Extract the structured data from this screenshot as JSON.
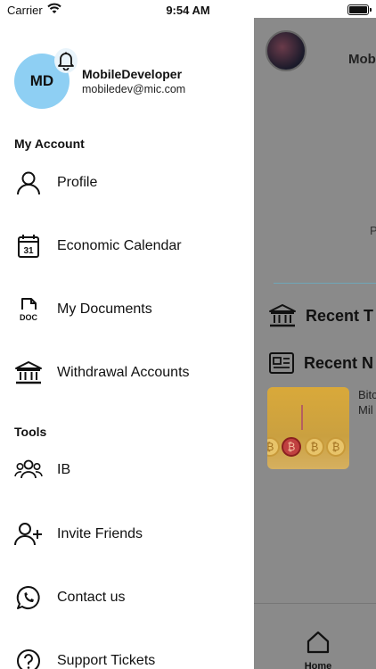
{
  "status_bar": {
    "carrier": "Carrier",
    "time": "9:54 AM"
  },
  "user": {
    "initials": "MD",
    "name": "MobileDeveloper",
    "email": "mobiledev@mic.com"
  },
  "sections": {
    "account_title": "My Account",
    "tools_title": "Tools"
  },
  "account_items": [
    {
      "label": "Profile",
      "icon": "person-icon"
    },
    {
      "label": "Economic Calendar",
      "icon": "calendar-icon"
    },
    {
      "label": "My Documents",
      "icon": "document-icon"
    },
    {
      "label": "Withdrawal Accounts",
      "icon": "bank-icon"
    }
  ],
  "tool_items": [
    {
      "label": "IB",
      "icon": "group-icon"
    },
    {
      "label": "Invite Friends",
      "icon": "add-user-icon"
    },
    {
      "label": "Contact us",
      "icon": "whatsapp-icon"
    },
    {
      "label": "Support Tickets",
      "icon": "help-icon"
    }
  ],
  "icon_texts": {
    "calendar_day": "31",
    "document_tag": "DOC"
  },
  "background": {
    "name_partial": "Mob",
    "p_partial": "P",
    "recent_transactions_partial": "Recent T",
    "recent_news_partial": "Recent N",
    "news_line1": "Bitc",
    "news_line2": "Mil",
    "tab_home": "Home"
  },
  "colors": {
    "avatar_bg": "#8ecff3",
    "overlay": "#8a8a8a"
  }
}
